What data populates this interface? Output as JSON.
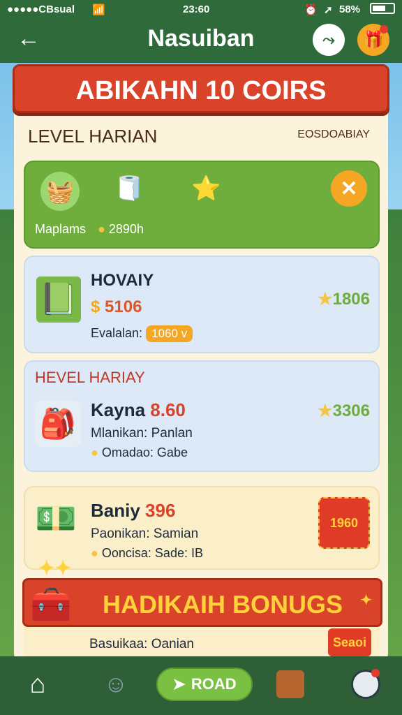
{
  "statusbar": {
    "carrier": "●●●●●CBsual",
    "time": "23:60",
    "battery": "58%"
  },
  "header": {
    "title": "Nasuiban",
    "back_icon": "arrow-left-icon"
  },
  "banner": {
    "text": "ABIKAHN 10 COIRS"
  },
  "section": {
    "title": "LEVEL HARIAN",
    "subtitle": "EOSDOABIAY"
  },
  "reward_bar": {
    "label": "Maplams",
    "coins": "2890h"
  },
  "cards": [
    {
      "name": "HOVAIY",
      "price": "5106",
      "detail_label": "Evalalan:",
      "detail_pill": "1060 v",
      "score": "1806"
    },
    {
      "heading": "HEVEL HARIAY",
      "name": "Kayna",
      "price": "8.60",
      "detail1": "Mlanikan: Panlan",
      "detail2": "Omadao: Gabe",
      "score": "3306"
    },
    {
      "name": "Baniy",
      "price": "396",
      "detail1": "Paonikan: Samian",
      "detail2": "Ooncisa: Sade: IB",
      "stamp": "1960"
    }
  ],
  "bonus": {
    "text": "HADIKAIH BONUGS",
    "detail": "Basuikaa: Oanian",
    "stamp": "Seaoi"
  },
  "navbar": {
    "road_label": "ROAD"
  },
  "colors": {
    "accent_red": "#d9432a",
    "green": "#6fad3c",
    "gold": "#f5a623"
  }
}
